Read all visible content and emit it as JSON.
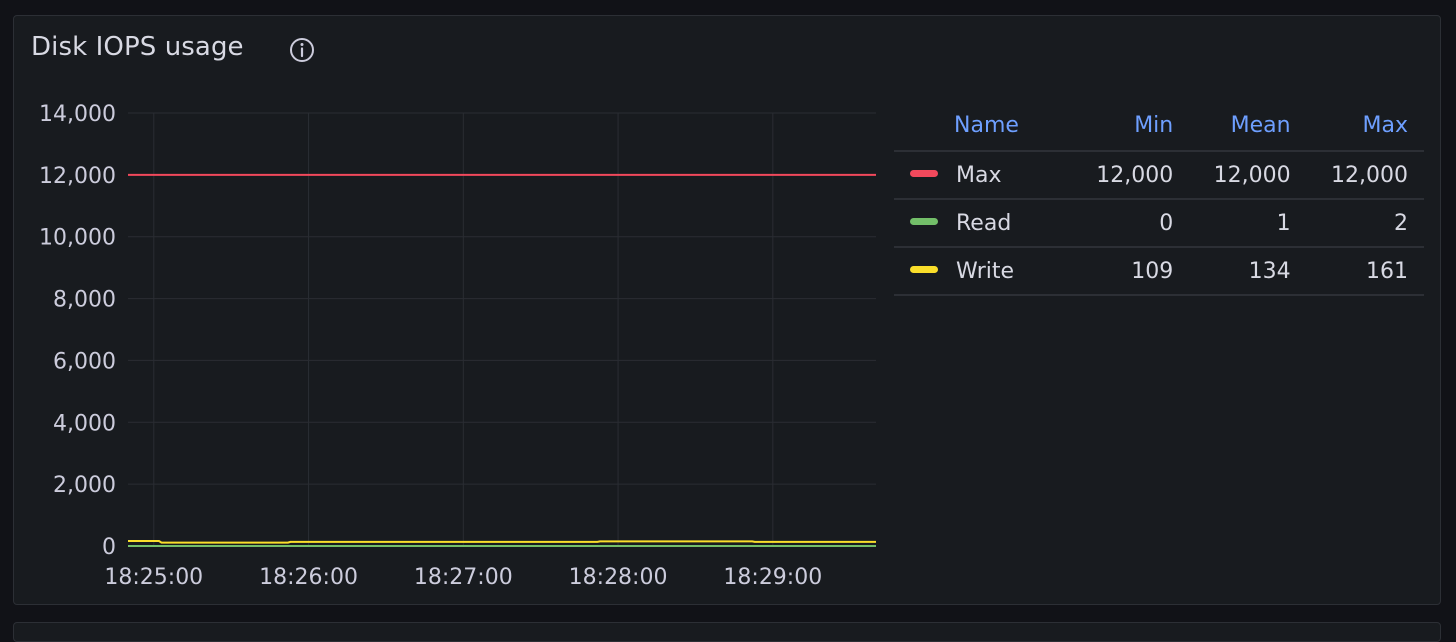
{
  "panel": {
    "title": "Disk IOPS usage",
    "info_icon": "info-circle-icon"
  },
  "chart_data": {
    "type": "line",
    "title": "Disk IOPS usage",
    "xlabel": "",
    "ylabel": "",
    "ylim": [
      0,
      14000
    ],
    "yticks": [
      0,
      2000,
      4000,
      6000,
      8000,
      10000,
      12000,
      14000
    ],
    "ytick_labels": [
      "0",
      "2,000",
      "4,000",
      "6,000",
      "8,000",
      "10,000",
      "12,000",
      "14,000"
    ],
    "xlim": [
      "18:24:50",
      "18:29:40"
    ],
    "xticks": [
      "18:25:00",
      "18:26:00",
      "18:27:00",
      "18:28:00",
      "18:29:00"
    ],
    "grid": true,
    "legend_placement": "right",
    "series": [
      {
        "name": "Max",
        "color": "#f2495c",
        "x": [
          "18:24:50",
          "18:29:40"
        ],
        "y": [
          12000,
          12000
        ]
      },
      {
        "name": "Read",
        "color": "#73bf69",
        "x": [
          "18:24:50",
          "18:29:40"
        ],
        "y": [
          1,
          1
        ]
      },
      {
        "name": "Write",
        "color": "#fade2a",
        "x": [
          "18:24:50",
          "18:25:02",
          "18:25:03",
          "18:25:52",
          "18:25:53",
          "18:27:52",
          "18:27:53",
          "18:28:52",
          "18:28:53",
          "18:29:40"
        ],
        "y": [
          161,
          161,
          109,
          109,
          134,
          134,
          150,
          150,
          134,
          134
        ]
      }
    ]
  },
  "legend": {
    "headers": {
      "name": "Name",
      "min": "Min",
      "mean": "Mean",
      "max": "Max"
    },
    "rows": [
      {
        "name": "Max",
        "color": "#f2495c",
        "min": "12,000",
        "mean": "12,000",
        "max": "12,000"
      },
      {
        "name": "Read",
        "color": "#73bf69",
        "min": "0",
        "mean": "1",
        "max": "2"
      },
      {
        "name": "Write",
        "color": "#fade2a",
        "min": "109",
        "mean": "134",
        "max": "161"
      }
    ]
  }
}
